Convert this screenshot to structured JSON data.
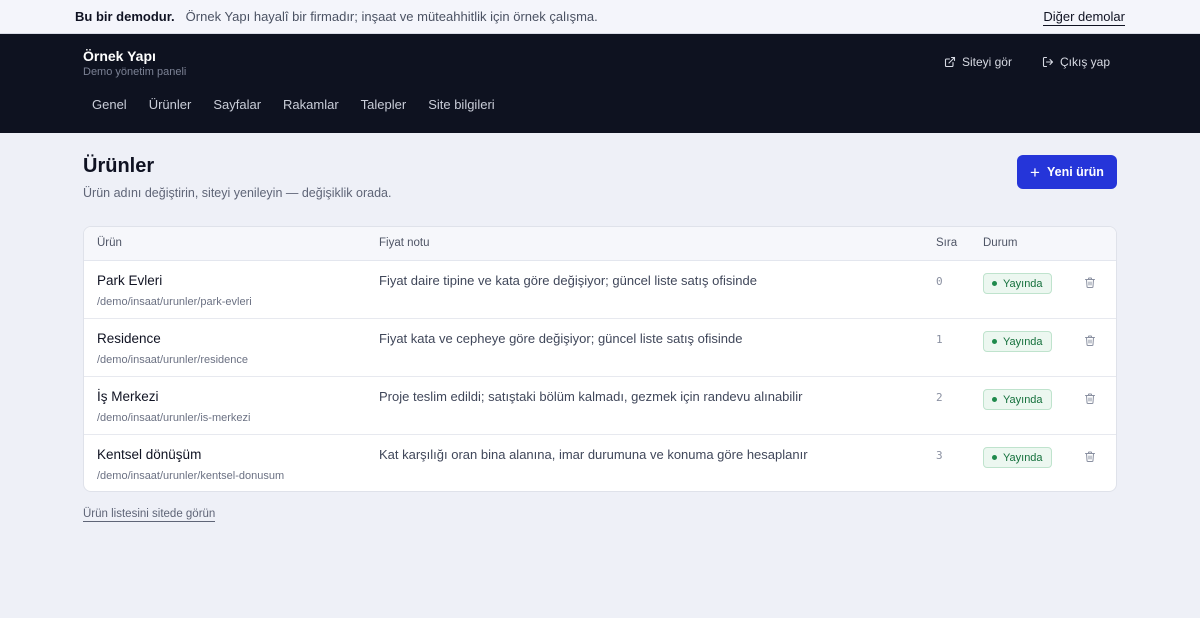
{
  "banner": {
    "title": "Bu bir demodur.",
    "description": "Örnek Yapı hayalî bir firmadır; inşaat ve müteahhitlik için örnek çalışma.",
    "other_demos": "Diğer demolar"
  },
  "header": {
    "brand": "Örnek Yapı",
    "subtitle": "Demo yönetim paneli",
    "actions": [
      {
        "label": "Siteyi gör",
        "icon": "external-link-icon"
      },
      {
        "label": "Çıkış yap",
        "icon": "logout-icon"
      }
    ],
    "nav": [
      "Genel",
      "Ürünler",
      "Sayfalar",
      "Rakamlar",
      "Talepler",
      "Site bilgileri"
    ]
  },
  "page": {
    "title": "Ürünler",
    "subtitle": "Ürün adını değiştirin, siteyi yenileyin — değişiklik orada.",
    "new_button": "Yeni ürün",
    "site_link": "Ürün listesini sitede görün"
  },
  "table": {
    "headers": {
      "product": "Ürün",
      "price_note": "Fiyat notu",
      "order": "Sıra",
      "status": "Durum"
    },
    "rows": [
      {
        "name": "Park Evleri",
        "path": "/demo/insaat/urunler/park-evleri",
        "price_note": "Fiyat daire tipine ve kata göre değişiyor; güncel liste satış ofisinde",
        "order": "0",
        "status": "Yayında"
      },
      {
        "name": "Residence",
        "path": "/demo/insaat/urunler/residence",
        "price_note": "Fiyat kata ve cepheye göre değişiyor; güncel liste satış ofisinde",
        "order": "1",
        "status": "Yayında"
      },
      {
        "name": "İş Merkezi",
        "path": "/demo/insaat/urunler/is-merkezi",
        "price_note": "Proje teslim edildi; satıştaki bölüm kalmadı, gezmek için randevu alınabilir",
        "order": "2",
        "status": "Yayında"
      },
      {
        "name": "Kentsel dönüşüm",
        "path": "/demo/insaat/urunler/kentsel-donusum",
        "price_note": "Kat karşılığı oran bina alanına, imar durumuna ve konuma göre hesaplanır",
        "order": "3",
        "status": "Yayında"
      }
    ]
  },
  "colors": {
    "header_bg": "#0e1220",
    "primary": "#2535d9",
    "status_green": "#14703c",
    "page_bg": "#eef0f7"
  }
}
